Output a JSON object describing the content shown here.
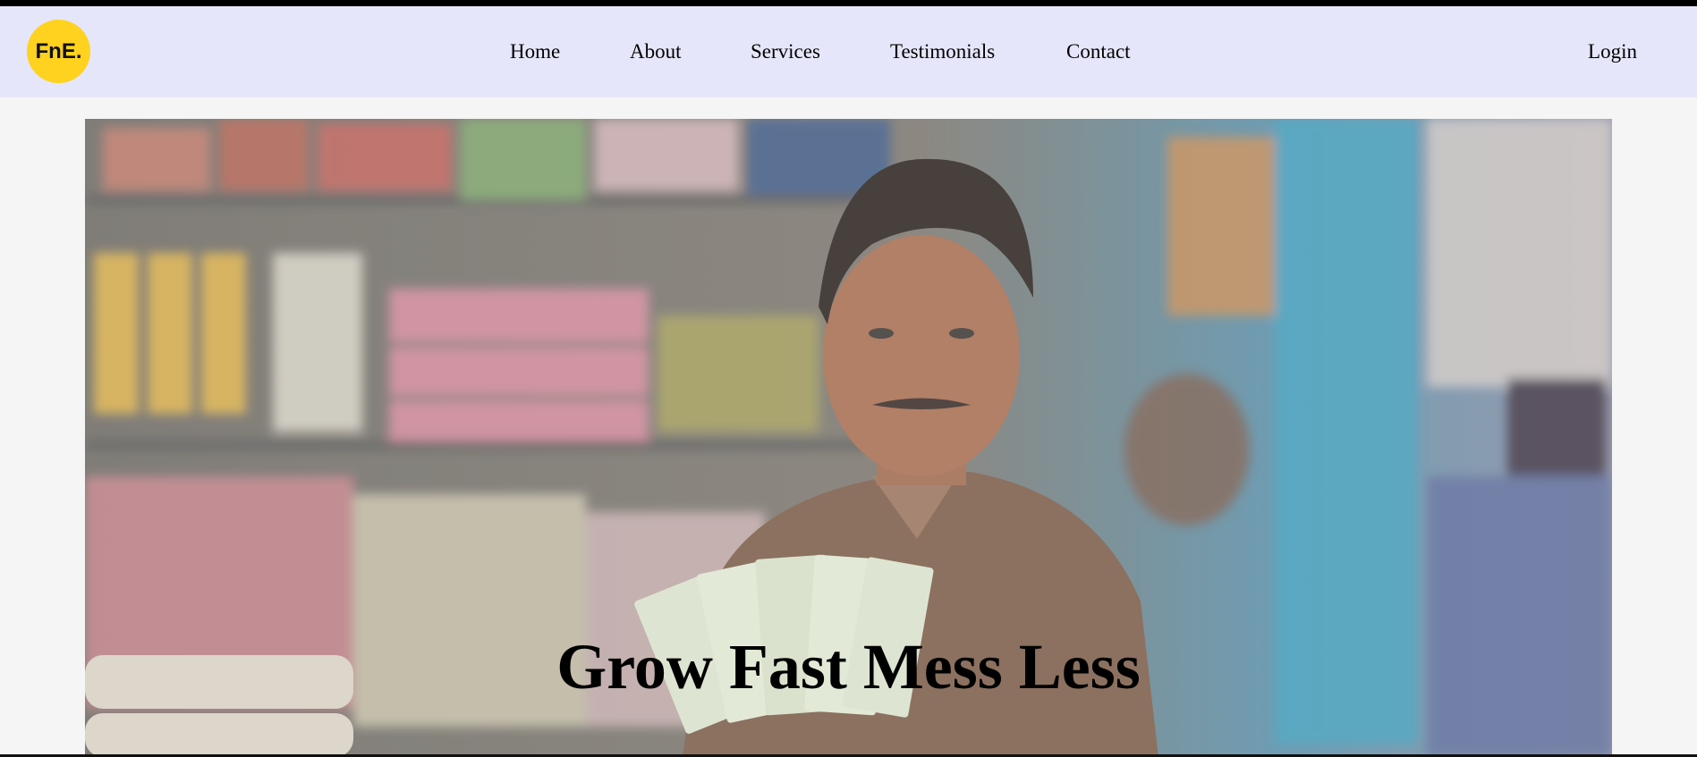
{
  "nav": {
    "logo_text": "FnE.",
    "links": [
      {
        "label": "Home"
      },
      {
        "label": "About"
      },
      {
        "label": "Services"
      },
      {
        "label": "Testimonials"
      },
      {
        "label": "Contact"
      }
    ],
    "login_label": "Login"
  },
  "hero": {
    "headline": "Grow Fast Mess Less",
    "background_image": "shopkeeper-holding-cash-photo"
  },
  "colors": {
    "navbar_bg": "#e6e6fa",
    "logo_bg": "#ffd21f",
    "page_bg": "#f5f5f5"
  }
}
